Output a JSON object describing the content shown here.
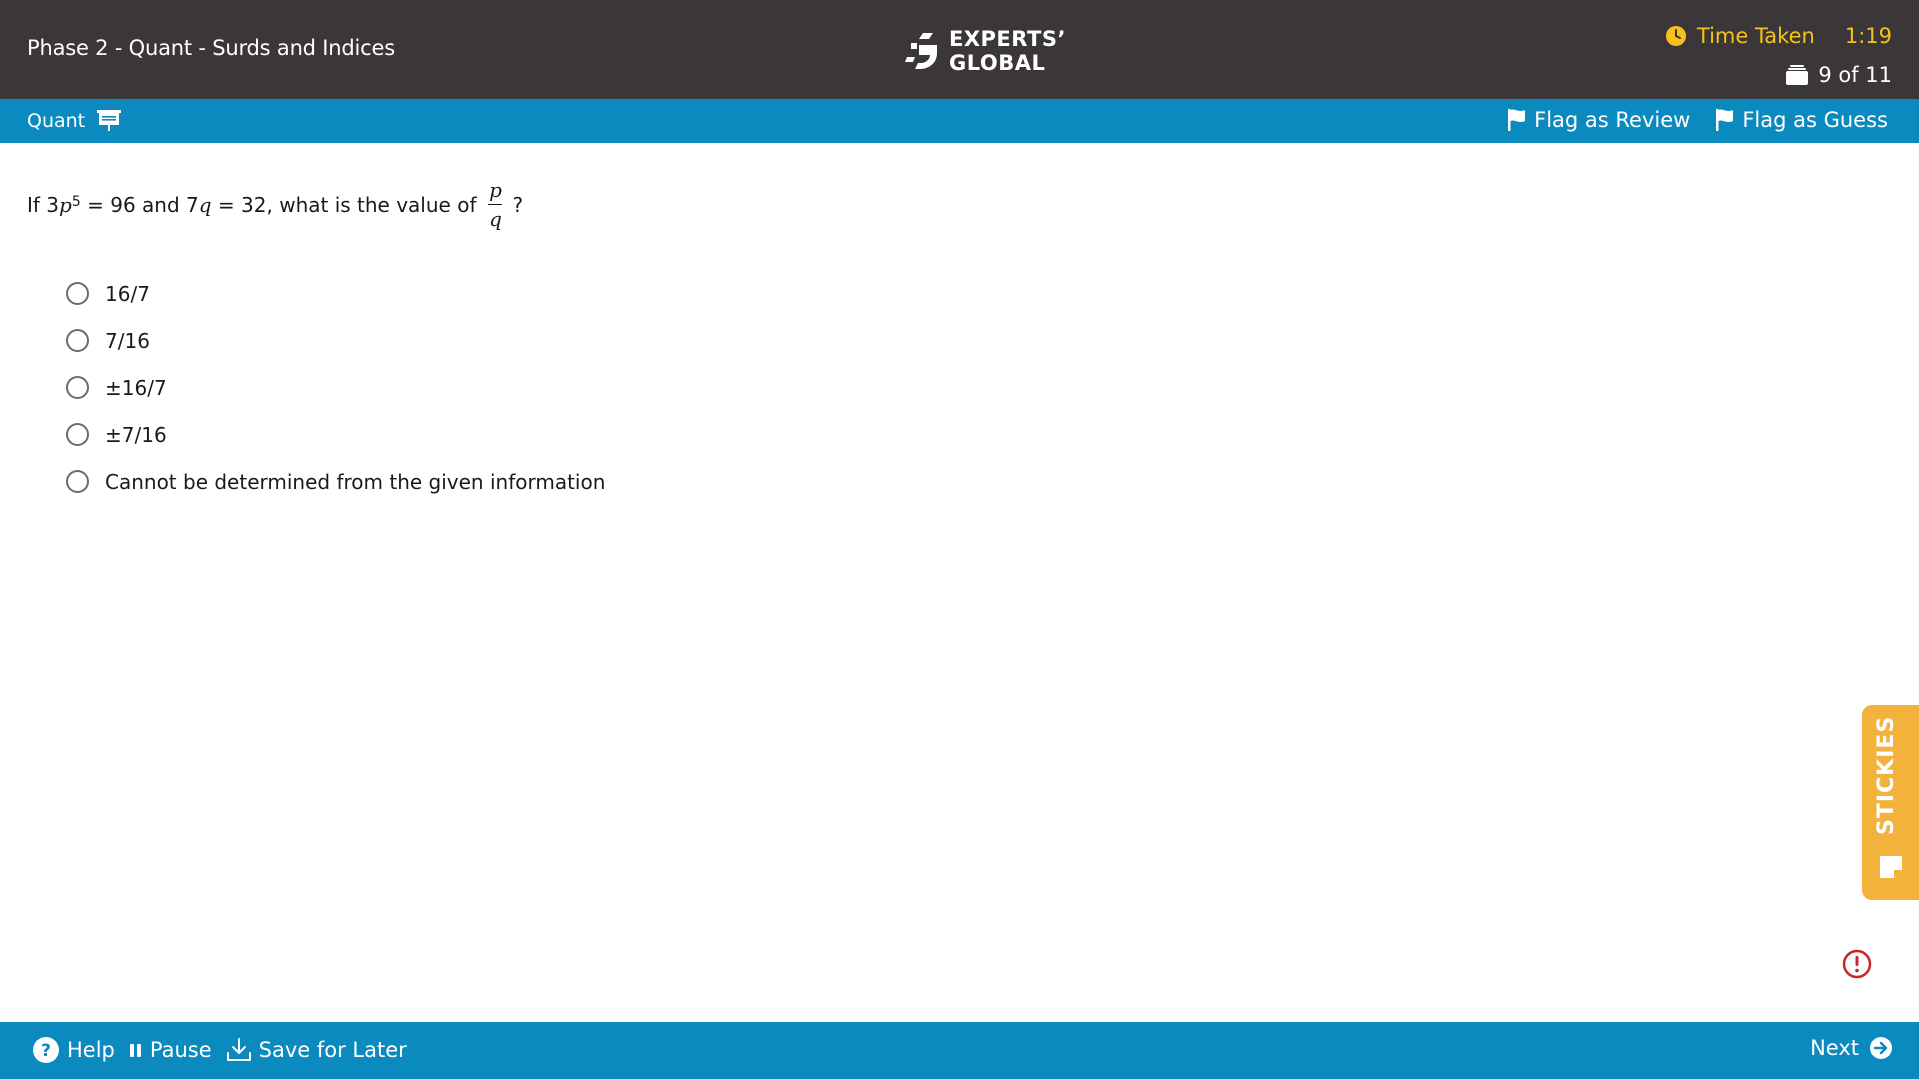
{
  "header": {
    "test_title": "Phase 2 - Quant - Surds and Indices",
    "logo_line1": "EXPERTS’",
    "logo_line2": "GLOBAL",
    "timer_label": "Time Taken",
    "timer_value": "1:19",
    "question_counter": "9 of 11"
  },
  "subbar": {
    "section_label": "Quant",
    "flag_review_label": "Flag as Review",
    "flag_guess_label": "Flag as Guess"
  },
  "question": {
    "prefix": "If 3",
    "var_p": "p",
    "exponent": "5",
    "middle": " = 96 and 7",
    "var_q": "q",
    "suffix": " = 32, what is the value of",
    "frac_num": "p",
    "frac_den": "q",
    "end": "?"
  },
  "options": [
    {
      "label": "16/7"
    },
    {
      "label": "7/16"
    },
    {
      "label": "±16/7"
    },
    {
      "label": "±7/16"
    },
    {
      "label": "Cannot be determined from the given information"
    }
  ],
  "stickies_label": "STICKIES",
  "footer": {
    "help_label": "Help",
    "pause_label": "Pause",
    "save_label": "Save for Later",
    "next_label": "Next"
  },
  "colors": {
    "header_bg": "#3b3738",
    "accent_blue": "#0b8ac0",
    "timer_yellow": "#f6c21a",
    "stickies_orange": "#f3b23b",
    "alert_red": "#c62828"
  },
  "icons": [
    "clock-icon",
    "stack-icon",
    "presentation-icon",
    "flag-icon",
    "help-icon",
    "pause-icon",
    "download-icon",
    "arrow-right-circle-icon",
    "sticky-note-icon",
    "alert-icon"
  ]
}
